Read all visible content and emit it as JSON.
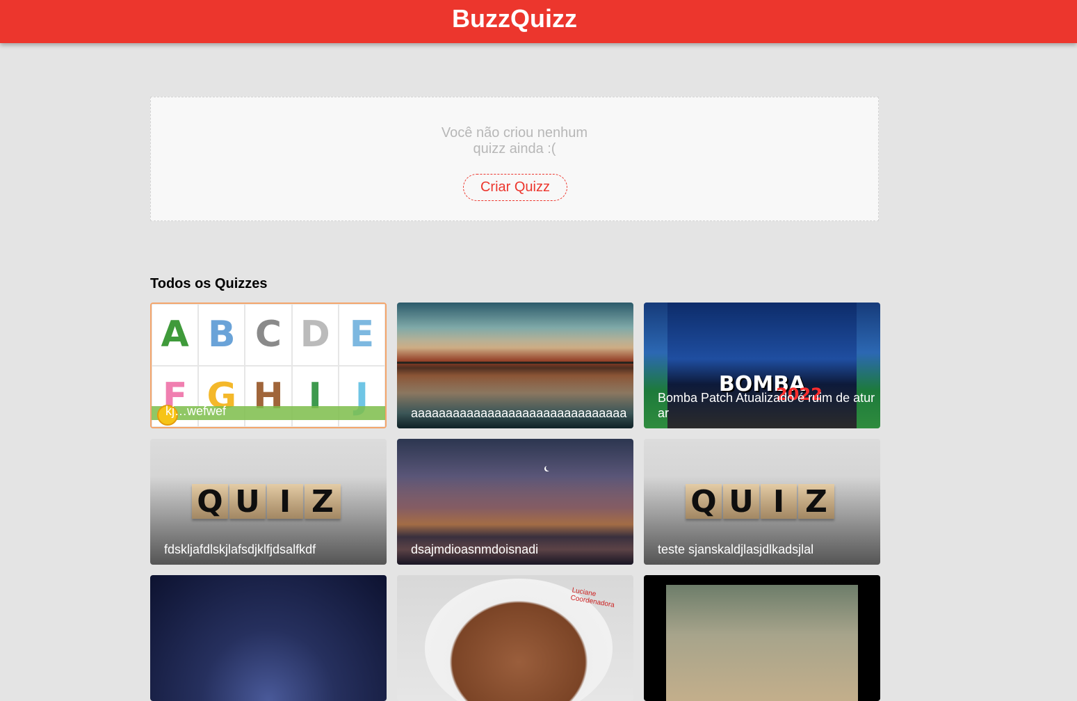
{
  "header": {
    "brand": "BuzzQuizz"
  },
  "user_quizzes": {
    "empty_message_line1": "Você não criou nenhum",
    "empty_message_line2": "quizz ainda :(",
    "create_button": "Criar Quizz"
  },
  "all_quizzes": {
    "title": "Todos os Quizzes",
    "cards": [
      {
        "title": "kj…wefwef"
      },
      {
        "title": "aaaaaaaaaaaaaaaaaaaaaaaaaaaaaaa"
      },
      {
        "title": "Bomba Patch Atualizado é ruim de aturar"
      },
      {
        "title": "fdskljafdlskjlafsdjklfjdsalfkdf"
      },
      {
        "title": "dsajmdioasnmdoisnadi"
      },
      {
        "title": "teste sjanskaldjlasjdlkadsjlal"
      },
      {
        "title": ""
      },
      {
        "title": ""
      },
      {
        "title": ""
      }
    ],
    "alphabet_letters": [
      "A",
      "B",
      "C",
      "D",
      "E",
      "F",
      "G",
      "H",
      "I",
      "J"
    ],
    "quiz_cube_letters": [
      "Q",
      "U",
      "I",
      "Z"
    ],
    "cover_text": {
      "bomba": "BOMBA",
      "year": "2022"
    },
    "dog_label": "Luciane Coordenadora"
  }
}
